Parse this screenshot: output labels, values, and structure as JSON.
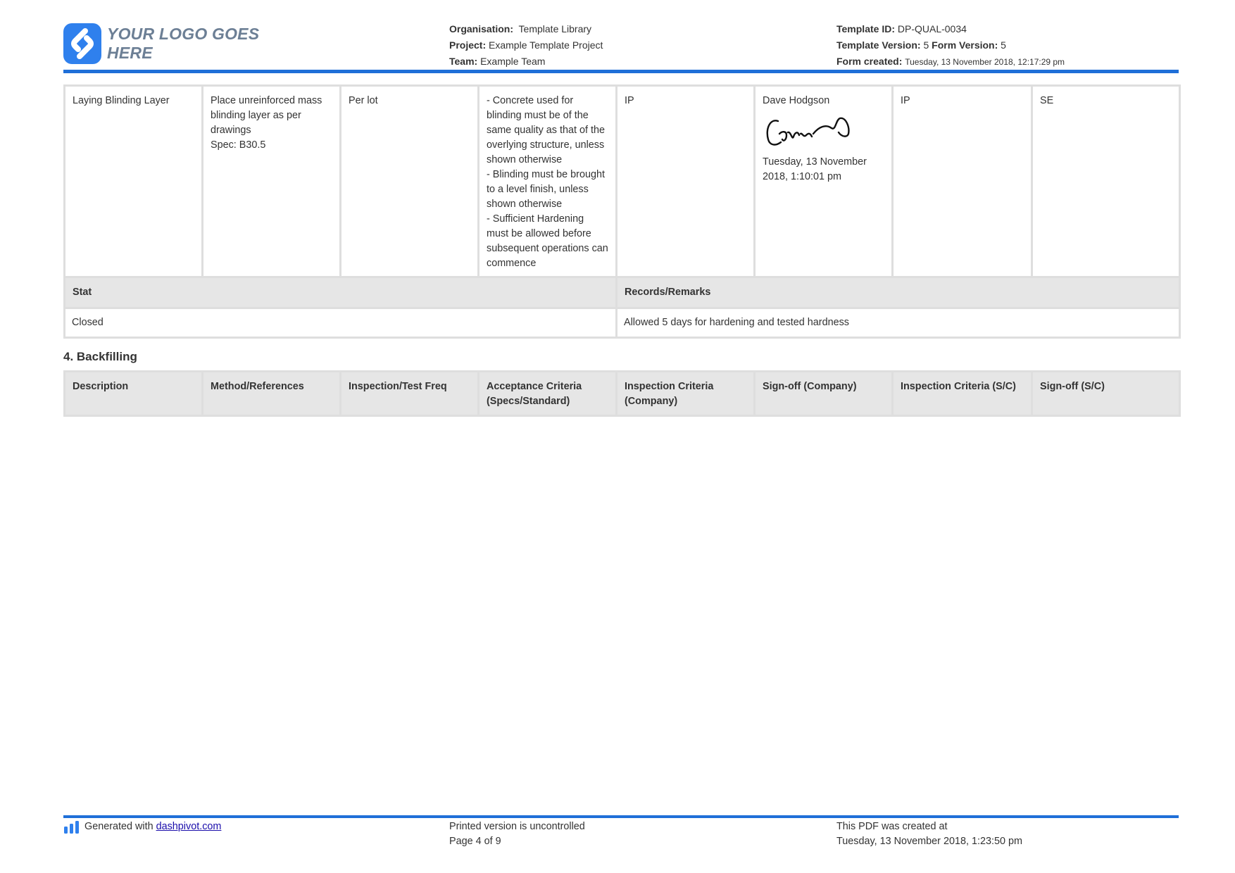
{
  "header": {
    "logo_text": "YOUR LOGO GOES HERE",
    "organisation_label": "Organisation:",
    "organisation_value": "Template Library",
    "project_label": "Project:",
    "project_value": "Example Template Project",
    "team_label": "Team:",
    "team_value": "Example Team",
    "template_id_label": "Template ID:",
    "template_id_value": "DP-QUAL-0034",
    "template_version_label": "Template Version:",
    "template_version_value": "5",
    "form_version_label": "Form Version:",
    "form_version_value": "5",
    "form_created_label": "Form created:",
    "form_created_value": "Tuesday, 13 November 2018, 12:17:29 pm"
  },
  "item_row": {
    "description": "Laying Blinding Layer",
    "method_lines": [
      "Place unreinforced mass blinding layer as per drawings",
      "Spec: B30.5"
    ],
    "frequency": "Per lot",
    "acceptance_lines": [
      "- Concrete used for blinding must be of the same quality as that of the overlying structure, unless shown otherwise",
      "- Blinding must be brought to a level finish, unless shown otherwise",
      "- Sufficient Hardening must be allowed before subsequent operations can commence"
    ],
    "inspection_company": "IP",
    "signoff_company_name": "Dave Hodgson",
    "signoff_company_date": "Tuesday, 13 November 2018, 1:10:01 pm",
    "inspection_sc": "IP",
    "signoff_sc": "SE"
  },
  "status_table": {
    "stat_header": "Stat",
    "remarks_header": "Records/Remarks",
    "stat_value": "Closed",
    "remarks_value": "Allowed 5 days for hardening and tested hardness"
  },
  "section": {
    "title": "4. Backfilling",
    "columns": [
      "Description",
      "Method/References",
      "Inspection/Test Freq",
      "Acceptance Criteria (Specs/Standard)",
      "Inspection Criteria (Company)",
      "Sign-off (Company)",
      "Inspection Criteria (S/C)",
      "Sign-off (S/C)"
    ]
  },
  "footer": {
    "generated_prefix": "Generated with",
    "generated_link": "dashpivot.com",
    "uncontrolled": "Printed version is uncontrolled",
    "page": "Page 4 of 9",
    "pdf_created_label": "This PDF was created at",
    "pdf_created_value": "Tuesday, 13 November 2018, 1:23:50 pm"
  },
  "colors": {
    "accent": "#1f6fd8",
    "logo_blue": "#2f80ed",
    "header_grey": "#e6e6e6",
    "border_grey": "#dedede"
  },
  "icons": {
    "logo": "logo-s-icon",
    "footer": "bar-chart-icon",
    "signature": "signature-image"
  }
}
